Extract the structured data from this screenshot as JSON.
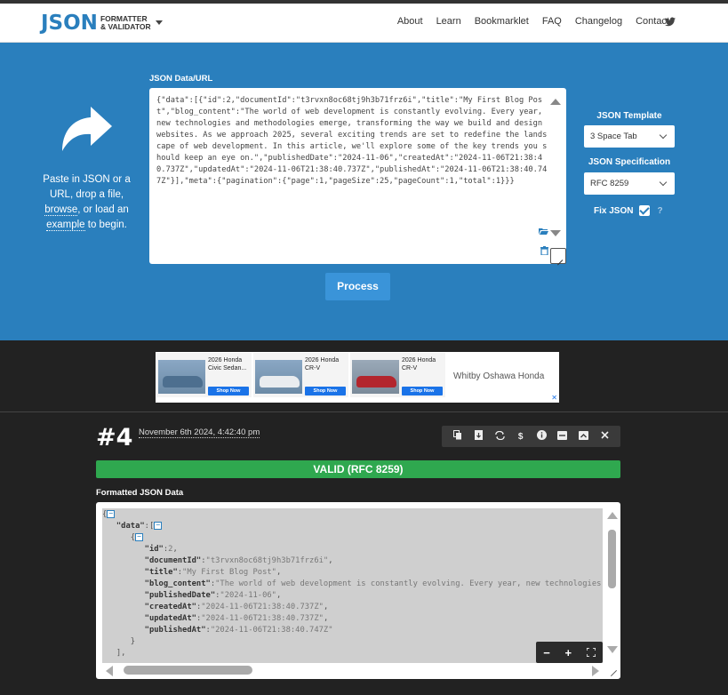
{
  "header": {
    "logo_main": "JSON",
    "logo_line1": "FORMATTER",
    "logo_line2": "& VALIDATOR",
    "nav": [
      "About",
      "Learn",
      "Bookmarklet",
      "FAQ",
      "Changelog",
      "Contact"
    ]
  },
  "hero": {
    "text_before_browse": "Paste in JSON or a URL, drop a file, ",
    "browse": "browse",
    "text_mid": ", or load an ",
    "example": "example",
    "text_after": " to begin.",
    "data_label": "JSON Data/URL",
    "json_input": "{\"data\":[{\"id\":2,\"documentId\":\"t3rvxn8oc68tj9h3b71frz6i\",\"title\":\"My First Blog Post\",\"blog_content\":\"The world of web development is constantly evolving. Every year, new technologies and methodologies emerge, transforming the way we build and design websites. As we approach 2025, several exciting trends are set to redefine the landscape of web development. In this article, we'll explore some of the key trends you should keep an eye on.\",\"publishedDate\":\"2024-11-06\",\"createdAt\":\"2024-11-06T21:38:40.737Z\",\"updatedAt\":\"2024-11-06T21:38:40.737Z\",\"publishedAt\":\"2024-11-06T21:38:40.747Z\"}],\"meta\":{\"pagination\":{\"page\":1,\"pageSize\":25,\"pageCount\":1,\"total\":1}}}",
    "process_label": "Process",
    "template_label": "JSON Template",
    "template_value": "3 Space Tab",
    "spec_label": "JSON Specification",
    "spec_value": "RFC 8259",
    "fix_label": "Fix JSON",
    "help": "?"
  },
  "ad": {
    "cards": [
      {
        "title": "2026 Honda Civic Sedan...",
        "shop": "Shop Now"
      },
      {
        "title": "2026 Honda CR-V",
        "shop": "Shop Now"
      },
      {
        "title": "2026 Honda CR-V",
        "shop": "Shop Now"
      }
    ],
    "dealer": "Whitby Oshawa Honda",
    "close": "✕"
  },
  "result": {
    "number": "#4",
    "date": "November 6th 2024, 4:42:40 pm",
    "valid": "VALID (RFC 8259)",
    "formatted_label": "Formatted JSON Data",
    "tree": {
      "data_key": "\"data\"",
      "id_key": "\"id\"",
      "id_val": "2",
      "doc_key": "\"documentId\"",
      "doc_val": "\"t3rvxn8oc68tj9h3b71frz6i\"",
      "title_key": "\"title\"",
      "title_val": "\"My First Blog Post\"",
      "content_key": "\"blog_content\"",
      "content_val": "\"The world of web development is constantly evolving. Every year, new technologies",
      "pubdate_key": "\"publishedDate\"",
      "pubdate_val": "\"2024-11-06\"",
      "created_key": "\"createdAt\"",
      "created_val": "\"2024-11-06T21:38:40.737Z\"",
      "updated_key": "\"updatedAt\"",
      "updated_val": "\"2024-11-06T21:38:40.737Z\"",
      "published_key": "\"publishedAt\"",
      "published_val": "\"2024-11-06T21:38:40.747Z\""
    }
  },
  "colors": {
    "brand_blue": "#2a7fbd",
    "valid_green": "#2fa84f",
    "dark_bg": "#222222"
  }
}
